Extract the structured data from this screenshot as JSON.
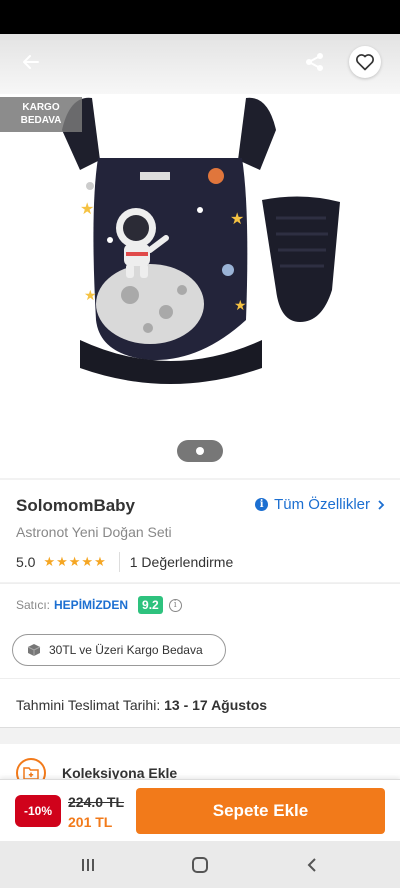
{
  "header": {
    "back_icon": "arrow-left-icon",
    "share_icon": "share-icon",
    "favorite_icon": "heart-icon"
  },
  "badge": {
    "line1": "KARGO",
    "line2": "BEDAVA"
  },
  "gallery": {
    "pages": 1,
    "current": 1
  },
  "product": {
    "brand": "SolomomBaby",
    "all_features": "Tüm Özellikler",
    "name": "Astronot Yeni Doğan Seti",
    "rating": "5.0",
    "stars": "★★★★★",
    "reviews": "1 Değerlendirme"
  },
  "seller": {
    "label": "Satıcı:",
    "name": "HEPİMİZDEN",
    "score": "9.2",
    "kargo_pill": "30TL ve Üzeri Kargo Bedava"
  },
  "delivery": {
    "label": "Tahmini Teslimat Tarihi:",
    "dates": "13 - 17 Ağustos"
  },
  "collection": {
    "label": "Koleksiyona Ekle"
  },
  "buy": {
    "discount": "-10%",
    "old_price": "224.0 TL",
    "new_price": "201 TL",
    "add_to_cart": "Sepete Ekle"
  },
  "colors": {
    "accent": "#f27a1a",
    "link": "#1c6fd1",
    "discount": "#d0021b",
    "score": "#2ec27e"
  }
}
